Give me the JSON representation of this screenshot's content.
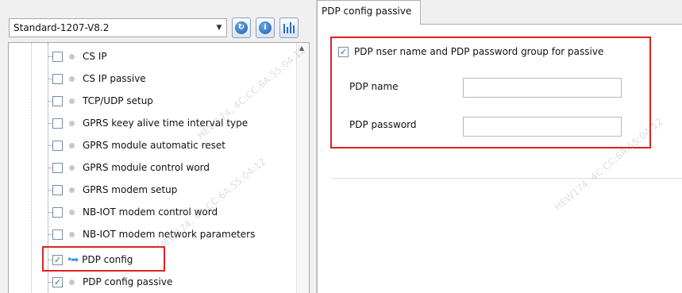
{
  "profile": {
    "selected": "Standard-1207-V8.2"
  },
  "toolbar": {
    "refresh_icon": "refresh-icon",
    "info_icon": "info-icon",
    "settings_icon": "sliders-icon"
  },
  "tree": {
    "items": [
      {
        "label": "CS IP",
        "checked": false
      },
      {
        "label": "CS IP passive",
        "checked": false
      },
      {
        "label": "TCP/UDP setup",
        "checked": false
      },
      {
        "label": "GPRS keey alive time interval type",
        "checked": false
      },
      {
        "label": "GPRS module automatic reset",
        "checked": false
      },
      {
        "label": "GPRS module control word",
        "checked": false
      },
      {
        "label": "GPRS modem setup",
        "checked": false
      },
      {
        "label": "NB-IOT modem control word",
        "checked": false
      },
      {
        "label": "NB-IOT modem network parameters",
        "checked": false
      },
      {
        "label": "PDP config",
        "checked": true
      },
      {
        "label": "PDP config passive",
        "checked": true
      }
    ],
    "check_mark": "✓",
    "arrow_glyph": "•➡"
  },
  "tab": {
    "label": "PDP config passive"
  },
  "group": {
    "title": "PDP nser name and PDP password group for passive",
    "checked": true,
    "check_mark": "✓"
  },
  "fields": {
    "pdp_name_label": "PDP name",
    "pdp_name_value": "",
    "pdp_password_label": "PDP password",
    "pdp_password_value": ""
  },
  "watermark": "HEW174, 4C:CC:6A:55:04:12"
}
